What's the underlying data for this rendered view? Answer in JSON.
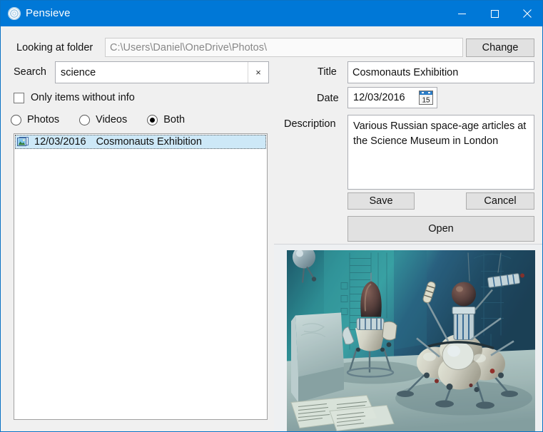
{
  "window": {
    "title": "Pensieve",
    "app_icon": "spiral-icon",
    "titlebar_color": "#0078d7",
    "controls": {
      "minimize": "minimize-icon",
      "maximize": "maximize-icon",
      "close": "close-icon"
    }
  },
  "folder": {
    "label": "Looking at folder",
    "path": "C:\\Users\\Daniel\\OneDrive\\Photos\\",
    "change_label": "Change"
  },
  "search": {
    "label": "Search",
    "value": "science",
    "placeholder": "",
    "clear_label": "×"
  },
  "filters": {
    "only_without_info_label": "Only items without info",
    "only_without_info_checked": false,
    "media_type_options": [
      "Photos",
      "Videos",
      "Both"
    ],
    "media_type_selected": "Both"
  },
  "list": {
    "items": [
      {
        "icon": "picture-icon",
        "date": "12/03/2016",
        "title": "Cosmonauts Exhibition",
        "selected": true
      }
    ]
  },
  "details": {
    "title_label": "Title",
    "title_value": "Cosmonauts Exhibition",
    "date_label": "Date",
    "date_value": "12/03/2016",
    "date_picker_icon": "calendar-icon",
    "date_picker_day": "15",
    "description_label": "Description",
    "description_value": "Various Russian space-age articles at the Science Museum in London",
    "save_label": "Save",
    "cancel_label": "Cancel",
    "open_label": "Open"
  },
  "preview": {
    "alt": "Soviet lunar lander modules on display in a museum gallery"
  },
  "colors": {
    "accent": "#0078d7",
    "selection": "#cde8f7",
    "button_face": "#e1e1e1",
    "window_face": "#f0f0f0"
  }
}
